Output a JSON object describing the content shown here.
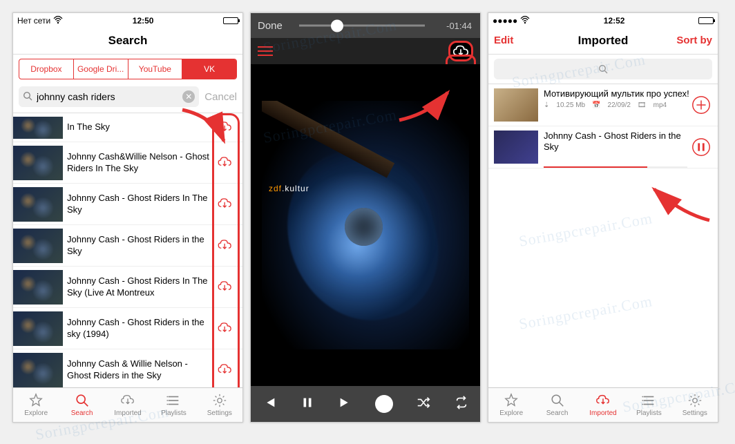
{
  "watermark": "Soringpcrepair.Com",
  "panel1": {
    "status_carrier": "Нет сети",
    "status_time": "12:50",
    "header_title": "Search",
    "source_tabs": {
      "items": [
        "Dropbox",
        "Google Dri...",
        "YouTube",
        "VK"
      ],
      "active_index": 3
    },
    "search_query": "johnny cash riders",
    "cancel_label": "Cancel",
    "results": [
      "In The Sky",
      "Johnny Cash&Willie Nelson - Ghost Riders In The Sky",
      "Johnny Cash - Ghost Riders In The Sky",
      "Johnny Cash - Ghost Riders in the Sky",
      "Johnny Cash - Ghost Riders In The Sky (Live At Montreux",
      "Johnny Cash - Ghost Riders in the sky (1994)",
      "Johnny Cash & Willie Nelson - Ghost Riders in the Sky"
    ],
    "tabs": [
      "Explore",
      "Search",
      "Imported",
      "Playlists",
      "Settings"
    ],
    "tab_active": 1
  },
  "panel2": {
    "done_label": "Done",
    "time_remaining": "-01:44",
    "channel_logo": "zdf.kultur"
  },
  "panel3": {
    "status_time": "12:52",
    "edit_label": "Edit",
    "header_title": "Imported",
    "sort_label": "Sort by",
    "items": [
      {
        "title": "Мотивирующий мультик про успех!",
        "size": "10.25 Mb",
        "date": "22/09/2",
        "format": "mp4",
        "action": "add"
      },
      {
        "title": "Johnny Cash - Ghost Riders in the Sky",
        "action": "pause"
      }
    ],
    "tabs": [
      "Explore",
      "Search",
      "Imported",
      "Playlists",
      "Settings"
    ],
    "tab_active": 2
  }
}
